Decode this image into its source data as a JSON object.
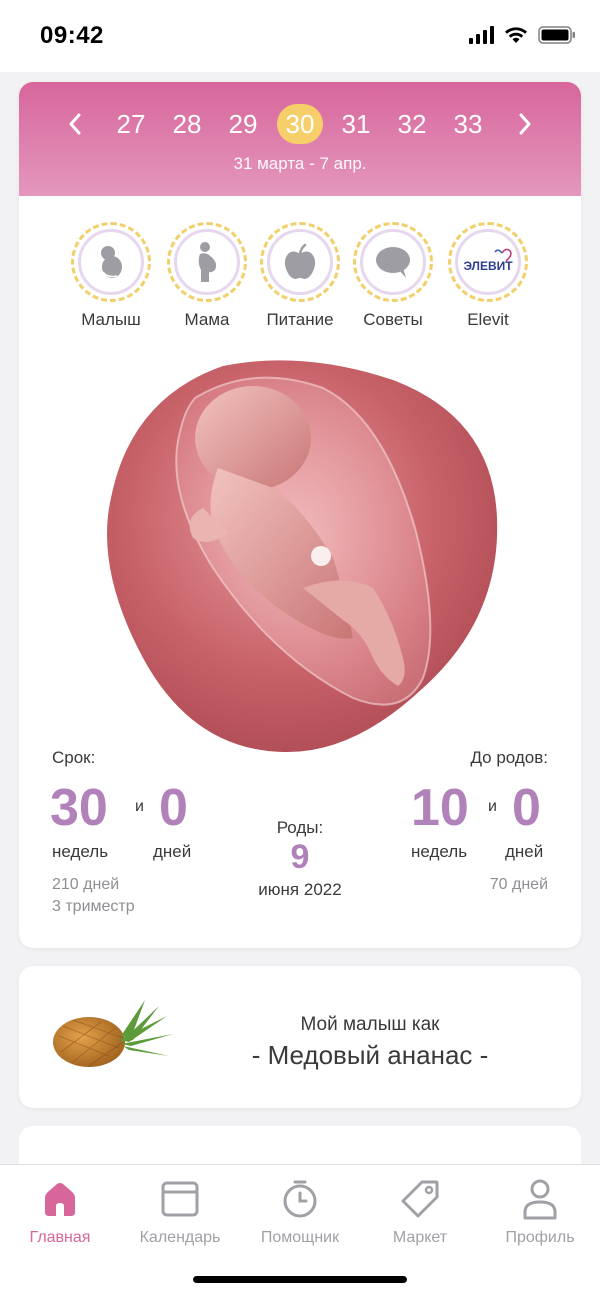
{
  "status_bar": {
    "time": "09:42"
  },
  "week_selector": {
    "weeks": [
      "27",
      "28",
      "29",
      "30",
      "31",
      "32",
      "33"
    ],
    "active_week": "30",
    "date_range": "31 марта - 7 апр."
  },
  "categories": [
    {
      "label": "Малыш",
      "icon": "baby-icon"
    },
    {
      "label": "Мама",
      "icon": "pregnant-woman-icon"
    },
    {
      "label": "Питание",
      "icon": "apple-icon"
    },
    {
      "label": "Советы",
      "icon": "speech-bubble-icon"
    },
    {
      "label": "Elevit",
      "icon": "elevit-logo",
      "logo_text": "ЭЛЕВИТ"
    }
  ],
  "stats": {
    "term_label": "Срок:",
    "term_weeks": "30",
    "term_and": "и",
    "term_days": "0",
    "term_weeks_unit": "недель",
    "term_days_unit": "дней",
    "term_total_days": "210 дней",
    "trimester": "3 триместр",
    "due_label": "Роды:",
    "due_day": "9",
    "due_month_year": "июня 2022",
    "left_label": "До родов:",
    "left_weeks": "10",
    "left_and": "и",
    "left_days": "0",
    "left_weeks_unit": "недель",
    "left_days_unit": "дней",
    "left_total_days": "70 дней"
  },
  "fruit_card": {
    "line1": "Мой малыш как",
    "line2": "- Медовый ананас -",
    "image": "pineapple"
  },
  "tabbar": [
    {
      "label": "Главная",
      "icon": "home-icon",
      "active": true
    },
    {
      "label": "Календарь",
      "icon": "calendar-icon",
      "active": false
    },
    {
      "label": "Помощник",
      "icon": "stopwatch-icon",
      "active": false
    },
    {
      "label": "Маркет",
      "icon": "tag-icon",
      "active": false
    },
    {
      "label": "Профиль",
      "icon": "profile-icon",
      "active": false
    }
  ],
  "colors": {
    "accent": "#d7669b",
    "numbers": "#b181ba",
    "active_week_bg": "#f7cf6a",
    "tab_inactive": "#a0a0a6"
  }
}
